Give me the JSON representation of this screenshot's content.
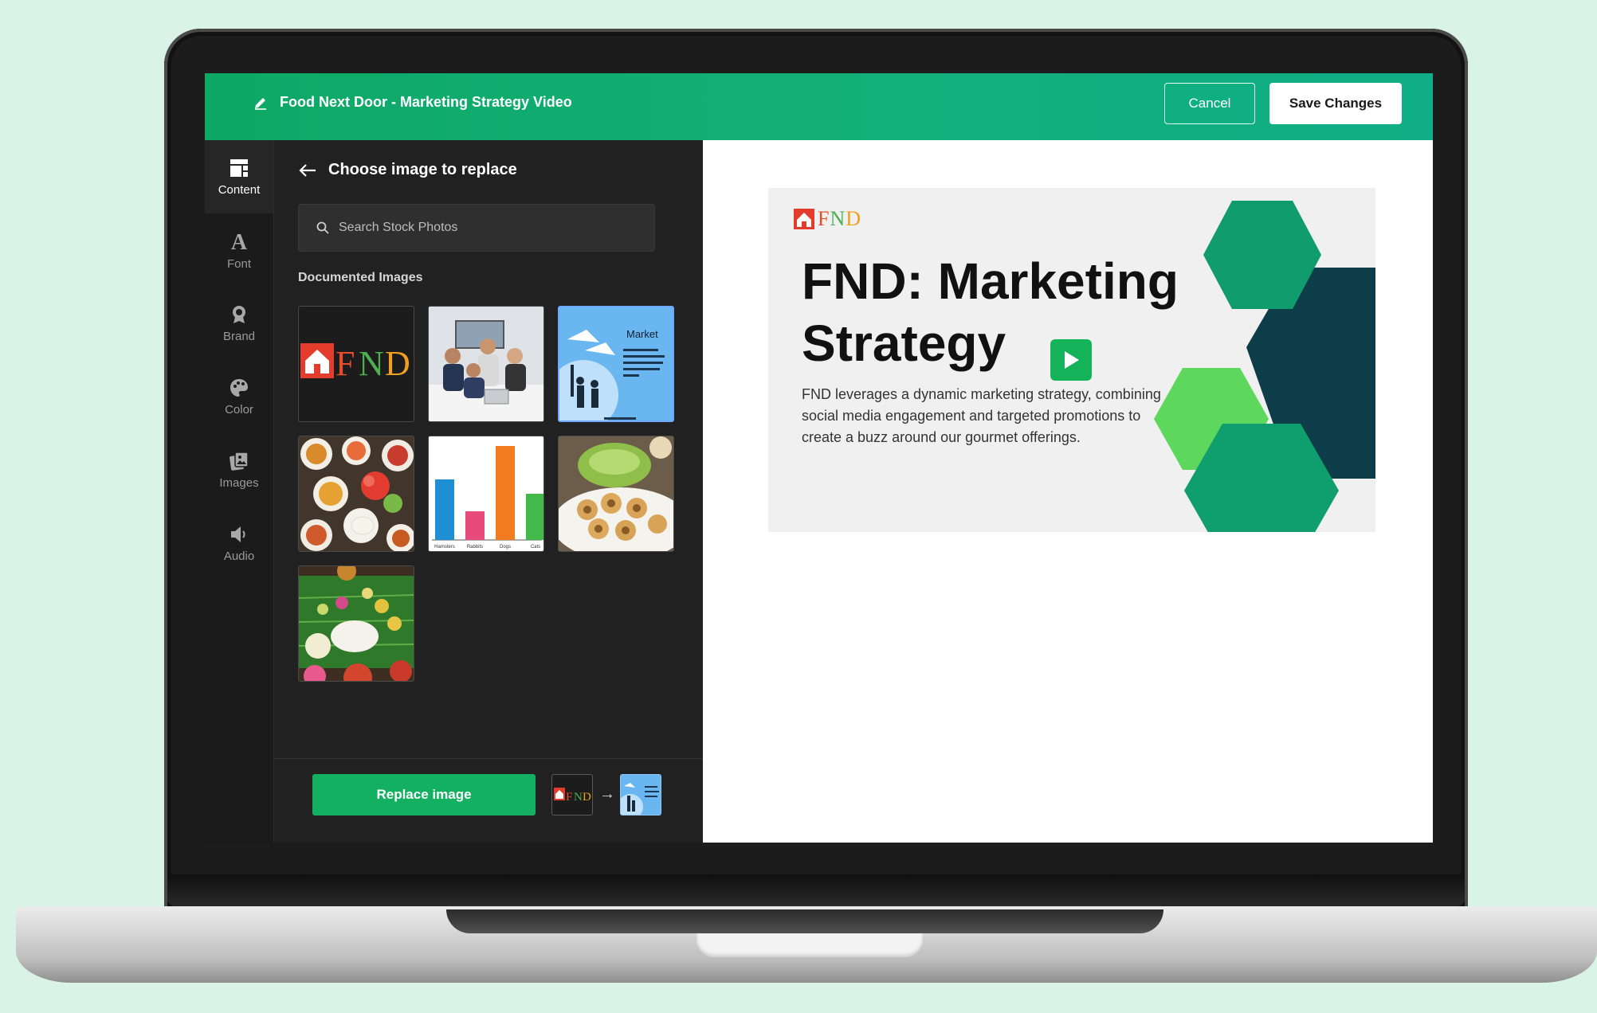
{
  "header": {
    "title": "Food Next Door - Marketing Strategy Video",
    "cancel_label": "Cancel",
    "save_label": "Save Changes"
  },
  "rail": {
    "items": [
      {
        "label": "Content",
        "icon": "layout-icon",
        "active": true
      },
      {
        "label": "Font",
        "icon": "font-icon"
      },
      {
        "label": "Brand",
        "icon": "brand-icon"
      },
      {
        "label": "Color",
        "icon": "palette-icon"
      },
      {
        "label": "Images",
        "icon": "images-icon"
      },
      {
        "label": "Audio",
        "icon": "speaker-icon"
      }
    ]
  },
  "panel": {
    "title": "Choose image to replace",
    "search_placeholder": "Search Stock Photos",
    "section_label": "Documented Images",
    "thumbnails": [
      {
        "name": "fnd-logo"
      },
      {
        "name": "team-meeting-photo"
      },
      {
        "name": "market-illustration",
        "selected": true,
        "title": "Market"
      },
      {
        "name": "food-spread-photo"
      },
      {
        "name": "bar-chart-image",
        "labels": [
          "Hamsters",
          "Rabbits",
          "Dogs",
          "Cats"
        ]
      },
      {
        "name": "pani-puri-photo"
      },
      {
        "name": "banana-leaf-meal-photo"
      }
    ],
    "replace_label": "Replace image"
  },
  "slide": {
    "logo_text": "FND",
    "title_line1": "FND: Marketing",
    "title_line2": "Strategy",
    "body": "FND leverages a dynamic marketing strategy, combining social media engagement and targeted promotions to create a buzz around our gourmet offerings."
  },
  "colors": {
    "brand_green": "#13b061",
    "panel_bg": "#212121",
    "hex_green": "#0f9e6e",
    "hex_dark": "#0d3d49",
    "hex_light": "#5ed85c"
  }
}
